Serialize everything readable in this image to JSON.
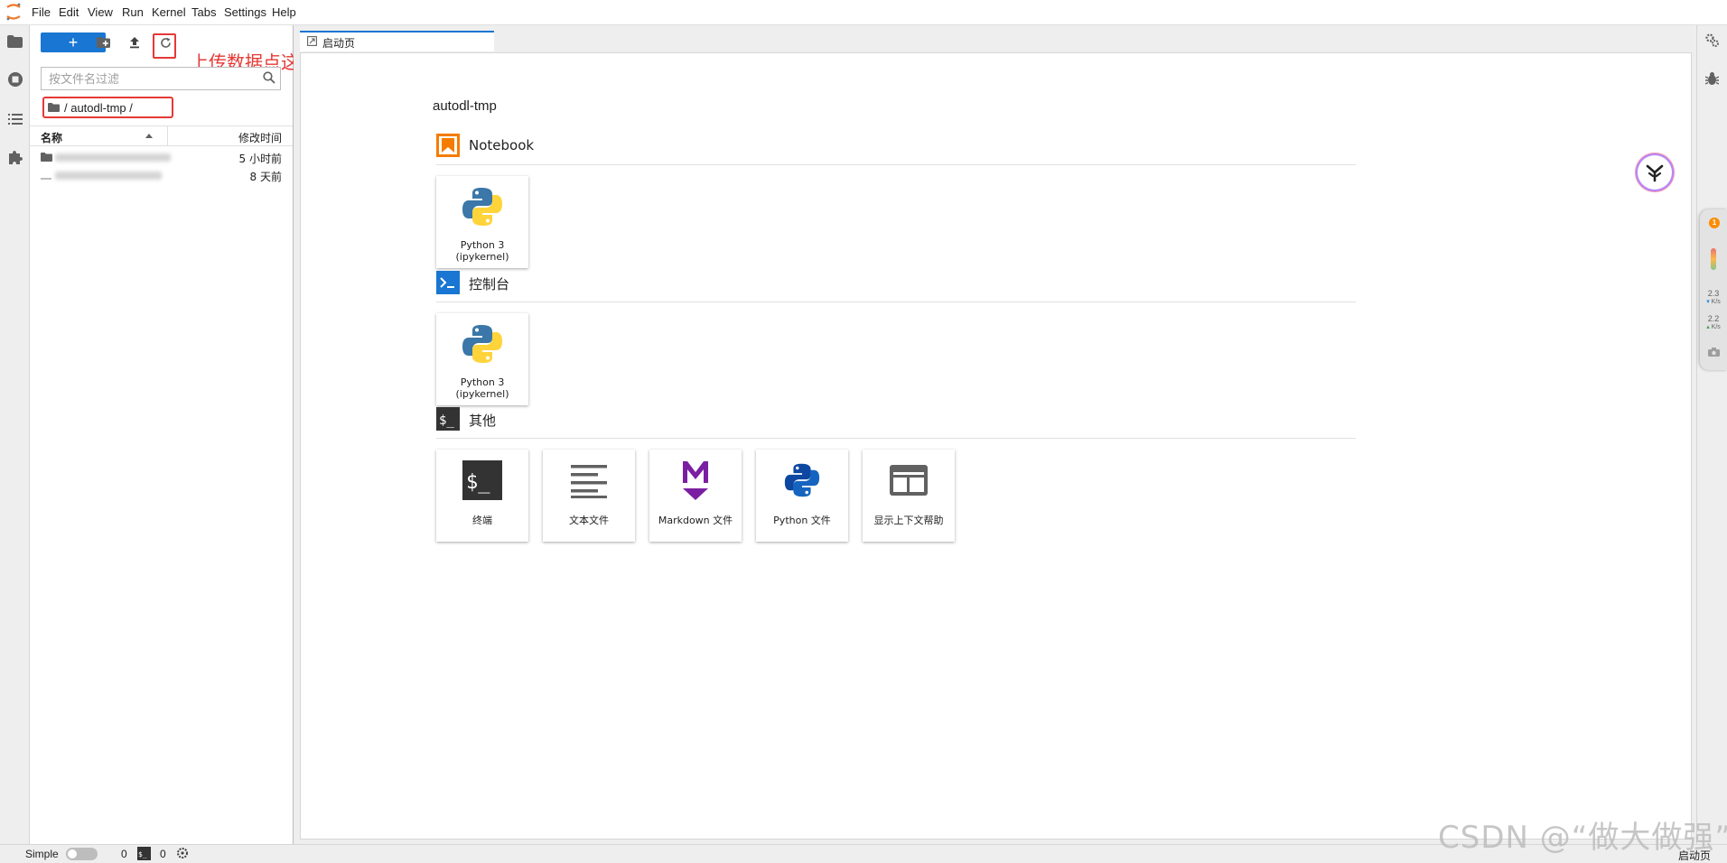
{
  "menubar": {
    "items": [
      "File",
      "Edit",
      "View",
      "Run",
      "Kernel",
      "Tabs",
      "Settings",
      "Help"
    ]
  },
  "filebrowser": {
    "new_launcher_label": "+",
    "annotation": "上传数据点这里",
    "filter_placeholder": "按文件名过滤",
    "breadcrumb": "/ autodl-tmp /",
    "columns": {
      "name": "名称",
      "modified": "修改时间"
    },
    "rows": [
      {
        "type": "folder",
        "modified": "5 小时前"
      },
      {
        "type": "file",
        "modified": "8 天前"
      }
    ]
  },
  "tabs": [
    {
      "label": "启动页",
      "active": true
    }
  ],
  "launcher": {
    "path": "autodl-tmp",
    "sections": [
      {
        "title": "Notebook",
        "cards": [
          {
            "label_line1": "Python 3",
            "label_line2": "(ipykernel)"
          }
        ]
      },
      {
        "title": "控制台",
        "cards": [
          {
            "label_line1": "Python 3",
            "label_line2": "(ipykernel)"
          }
        ]
      },
      {
        "title": "其他",
        "cards": [
          {
            "label": "终端"
          },
          {
            "label": "文本文件"
          },
          {
            "label": "Markdown 文件"
          },
          {
            "label": "Python 文件"
          },
          {
            "label": "显示上下文帮助"
          }
        ]
      }
    ]
  },
  "netmon": {
    "badge": "1",
    "down_value": "2.3",
    "down_unit": "K/s",
    "up_value": "2.2",
    "up_unit": "K/s"
  },
  "statusbar": {
    "mode_label": "Simple",
    "kernels_count": "0",
    "terminals_count": "0",
    "current_tab": "启动页"
  },
  "watermark": "CSDN @“做大做强”",
  "colors": {
    "accent": "#1976d2",
    "annotation": "#e53935",
    "notebook_icon": "#f57c00",
    "console_icon": "#1976d2",
    "markdown_icon": "#7b1fa2"
  }
}
